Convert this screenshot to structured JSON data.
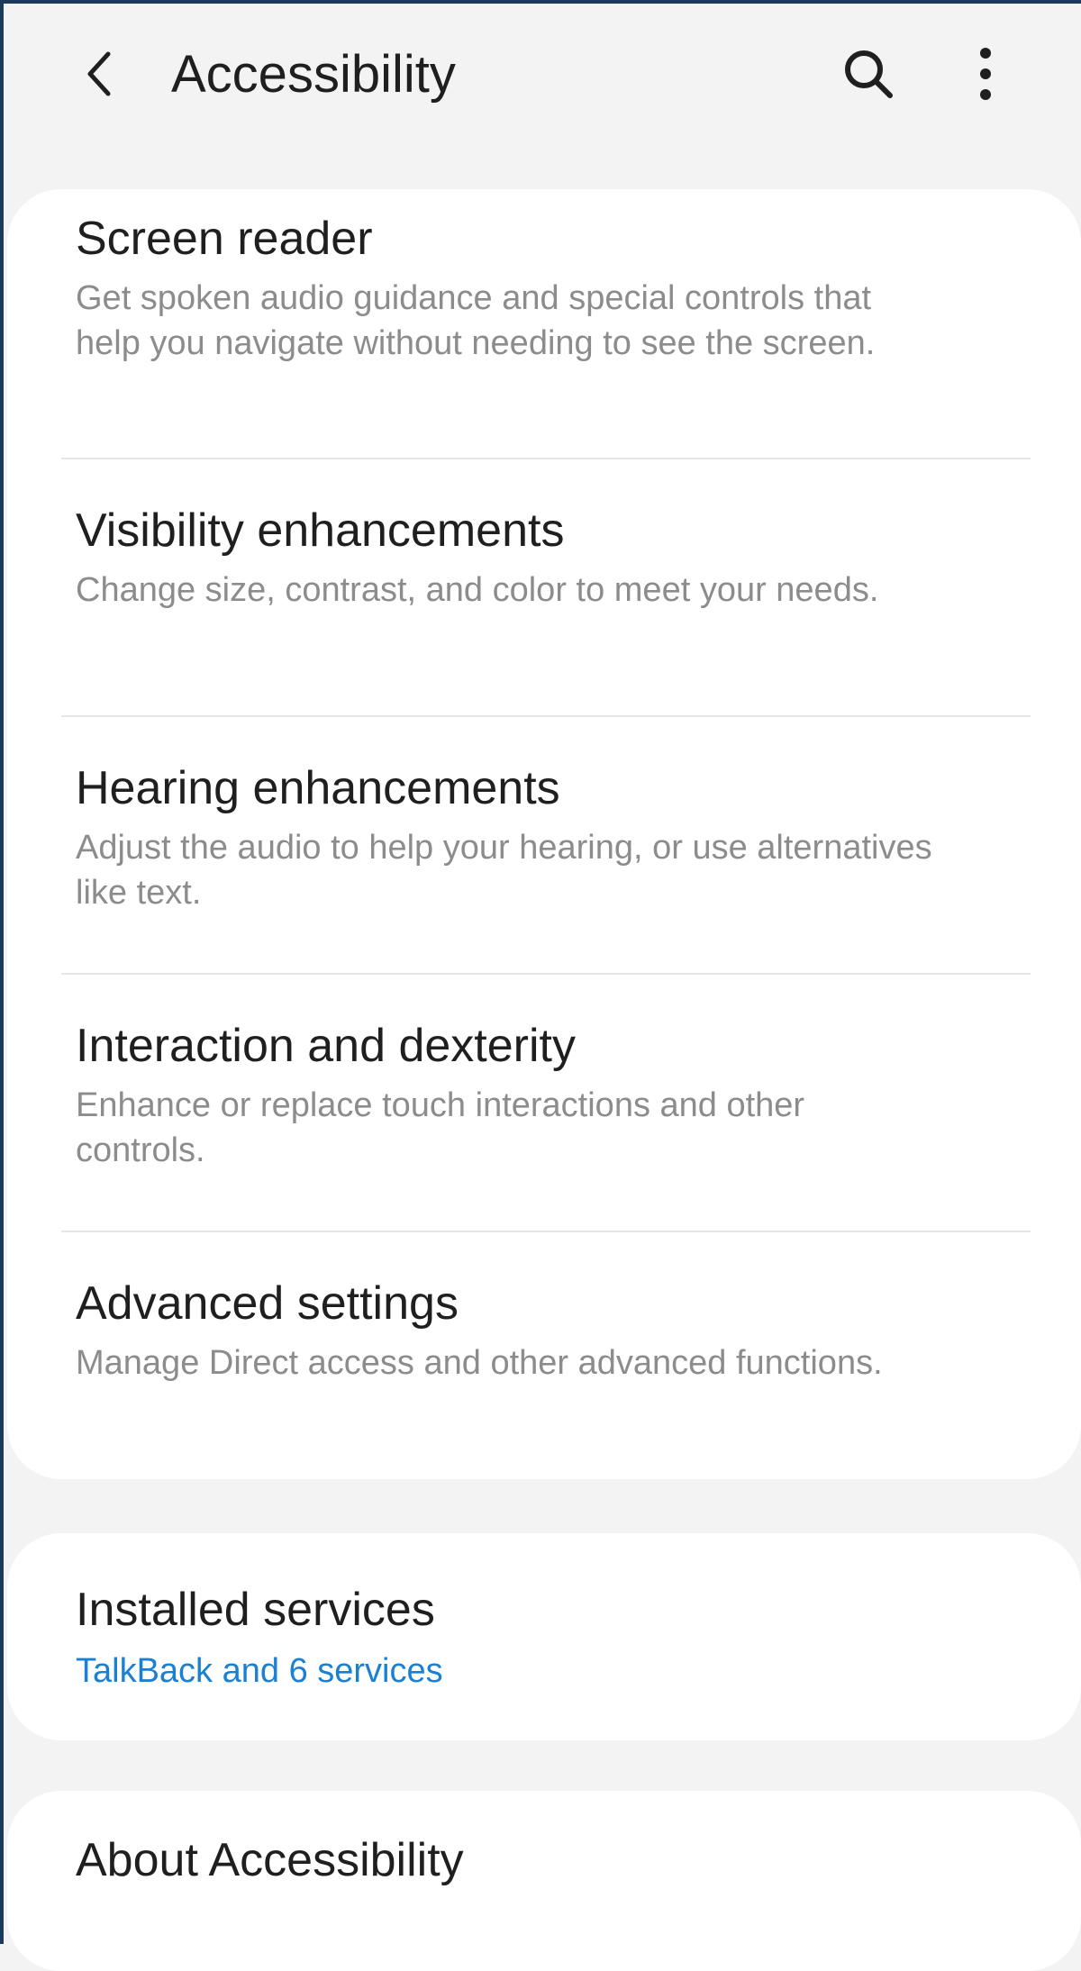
{
  "header": {
    "title": "Accessibility",
    "back_icon": "chevron-left-icon",
    "search_icon": "search-icon",
    "more_icon": "more-vertical-icon"
  },
  "main_items": [
    {
      "title": "Screen reader",
      "description": "Get spoken audio guidance and special controls that help you navigate without needing to see the screen."
    },
    {
      "title": "Visibility enhancements",
      "description": "Change size, contrast, and color to meet your needs."
    },
    {
      "title": "Hearing enhancements",
      "description": "Adjust the audio to help your hearing, or use alternatives like text."
    },
    {
      "title": "Interaction and dexterity",
      "description": "Enhance or replace touch interactions and other controls."
    },
    {
      "title": "Advanced settings",
      "description": "Manage Direct access and other advanced functions."
    }
  ],
  "services": {
    "title": "Installed services",
    "subtitle": "TalkBack and 6 services"
  },
  "about": {
    "title": "About Accessibility"
  },
  "colors": {
    "background": "#f3f3f3",
    "card": "#ffffff",
    "title_text": "#1f1f1f",
    "description_text": "#8c8c8c",
    "accent_link": "#1a80d4"
  }
}
